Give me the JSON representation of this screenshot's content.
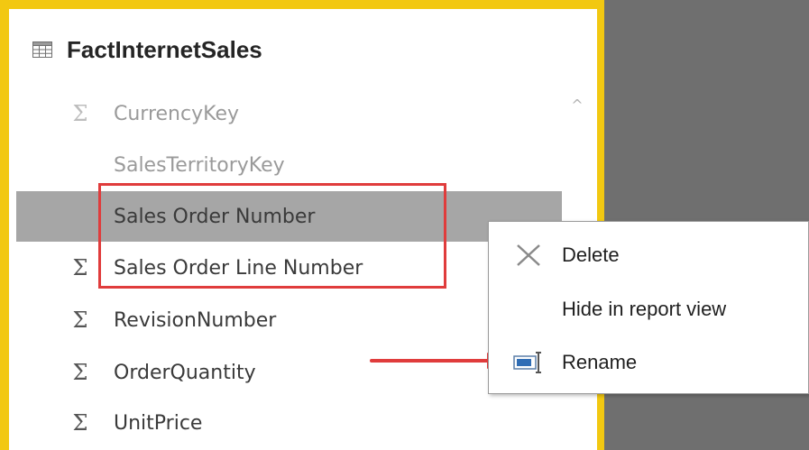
{
  "table": {
    "name": "FactInternetSales",
    "icon": "table-icon"
  },
  "fields": [
    {
      "label": "CurrencyKey",
      "icon": "sigma-icon",
      "state": "faded"
    },
    {
      "label": "SalesTerritoryKey",
      "icon": "",
      "state": "faded"
    },
    {
      "label": "Sales Order Number",
      "icon": "",
      "state": "selected"
    },
    {
      "label": "Sales Order Line Number",
      "icon": "sigma-icon",
      "state": "normal"
    },
    {
      "label": "RevisionNumber",
      "icon": "sigma-icon",
      "state": "normal"
    },
    {
      "label": "OrderQuantity",
      "icon": "sigma-icon",
      "state": "normal"
    },
    {
      "label": "UnitPrice",
      "icon": "sigma-icon",
      "state": "normal"
    }
  ],
  "sigma_glyph": "Σ",
  "scrollbar": {
    "up_glyph": "^"
  },
  "context_menu": {
    "items": [
      {
        "label": "Delete",
        "icon": "delete-x-icon"
      },
      {
        "label": "Hide in report view",
        "icon": ""
      },
      {
        "label": "Rename",
        "icon": "rename-icon"
      }
    ]
  },
  "colors": {
    "panel_border": "#f2c811",
    "selected_row": "#a6a6a6",
    "highlight": "#e03c3c",
    "right_background": "#6f6f6f"
  }
}
